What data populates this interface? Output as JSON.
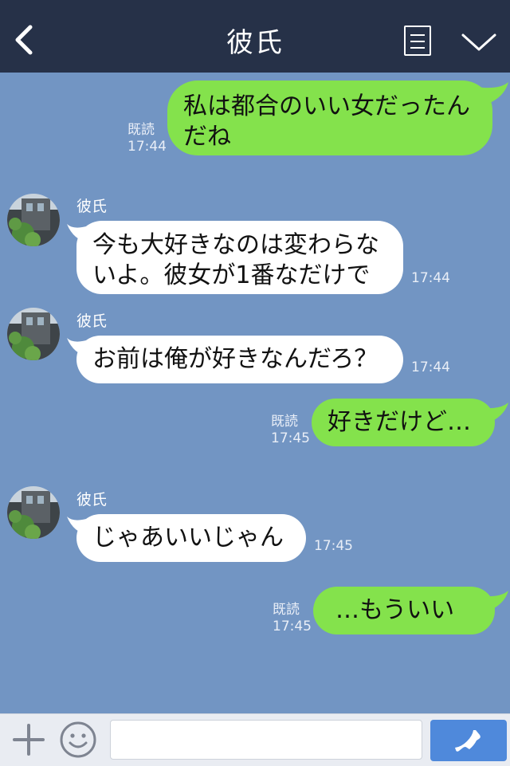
{
  "header": {
    "title": "彼氏"
  },
  "read_label": "既読",
  "contact_name": "彼氏",
  "messages": [
    {
      "side": "right",
      "text": "私は都合のいい女だったんだね",
      "line1": "私は都合のいい女だったん",
      "line2": "だね",
      "read": "既読",
      "time": "17:44"
    },
    {
      "side": "left",
      "name": "彼氏",
      "line1": "今も大好きなのは変わらな",
      "line2": "いよ。彼女が1番なだけで",
      "time": "17:44"
    },
    {
      "side": "left",
      "name": "彼氏",
      "text": "お前は俺が好きなんだろ？",
      "time": "17:44"
    },
    {
      "side": "right",
      "text": "好きだけど…",
      "read": "既読",
      "time": "17:45"
    },
    {
      "side": "left",
      "name": "彼氏",
      "text": "じゃあいいじゃん",
      "time": "17:45"
    },
    {
      "side": "right",
      "text": "…もういい",
      "read": "既読",
      "time": "17:45"
    }
  ],
  "footer": {
    "input_value": "",
    "icons": [
      "plus-icon",
      "smile-icon",
      "phone-icon"
    ]
  },
  "colors": {
    "header_bg": "#263148",
    "chat_bg": "#7295c3",
    "my_bubble": "#84e24c",
    "their_bubble": "#ffffff",
    "call_button": "#4f89db"
  }
}
